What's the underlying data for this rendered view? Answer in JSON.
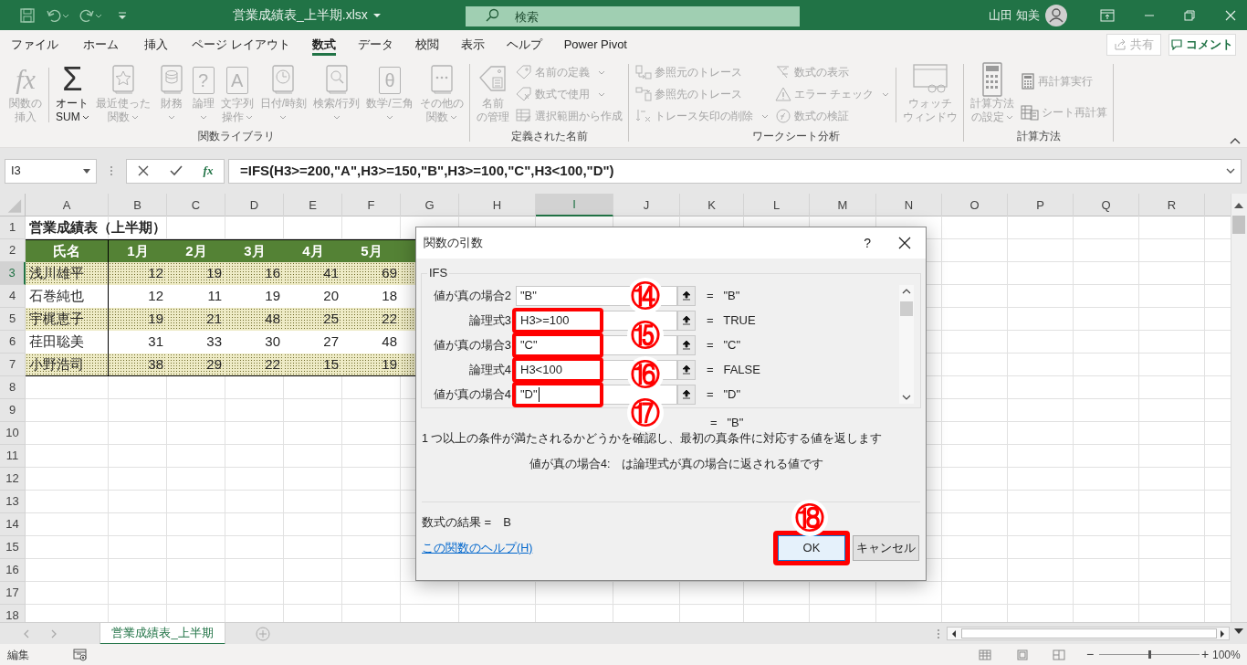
{
  "title_bar": {
    "filename": "営業成績表_上半期.xlsx",
    "search_placeholder": "検索",
    "user": "山田 知美"
  },
  "ribbon_tabs": [
    {
      "label": "ファイル",
      "selected": false
    },
    {
      "label": "ホーム",
      "selected": false
    },
    {
      "label": "挿入",
      "selected": false
    },
    {
      "label": "ページ レイアウト",
      "selected": false
    },
    {
      "label": "数式",
      "selected": true
    },
    {
      "label": "データ",
      "selected": false
    },
    {
      "label": "校閲",
      "selected": false
    },
    {
      "label": "表示",
      "selected": false
    },
    {
      "label": "ヘルプ",
      "selected": false
    },
    {
      "label": "Power Pivot",
      "selected": false
    }
  ],
  "share_button": {
    "label": "共有",
    "disabled": true
  },
  "comment_button": {
    "label": "コメント"
  },
  "ribbon_groups": [
    {
      "label": "関数ライブラリ",
      "buttons": [
        {
          "kind": "large",
          "glyph": "fx",
          "lines": [
            "関数の",
            "挿入"
          ],
          "dropdown": false,
          "disabled": true,
          "separated": true
        },
        {
          "kind": "large",
          "glyph": "Σ",
          "lines": [
            "オート",
            "SUM"
          ],
          "dropdown": true,
          "disabled": false,
          "separated": false
        },
        {
          "kind": "large",
          "lines": [
            "最近使った",
            "関数"
          ],
          "dropdown": true,
          "disabled": true,
          "separated": false
        },
        {
          "kind": "large",
          "lines": [
            "財務"
          ],
          "dropdown": true,
          "disabled": true,
          "separated": false
        },
        {
          "kind": "large",
          "glyph": "?",
          "lines": [
            "論理"
          ],
          "dropdown": true,
          "disabled": true,
          "separated": false
        },
        {
          "kind": "large",
          "glyph": "A",
          "lines": [
            "文字列",
            "操作"
          ],
          "dropdown": true,
          "disabled": true,
          "separated": false
        },
        {
          "kind": "large",
          "lines": [
            "日付/時刻"
          ],
          "dropdown": true,
          "disabled": true,
          "separated": false
        },
        {
          "kind": "large",
          "lines": [
            "検索/行列"
          ],
          "dropdown": true,
          "disabled": true,
          "separated": false
        },
        {
          "kind": "large",
          "glyph": "θ",
          "lines": [
            "数学/三角"
          ],
          "dropdown": true,
          "disabled": true,
          "separated": false
        },
        {
          "kind": "large",
          "lines": [
            "その他の",
            "関数"
          ],
          "dropdown": true,
          "disabled": true,
          "separated": false
        }
      ]
    },
    {
      "label": "定義された名前",
      "buttons": [
        {
          "kind": "large",
          "lines": [
            "名前",
            "の管理"
          ],
          "dropdown": false,
          "disabled": true,
          "separated": false
        },
        {
          "kind": "small",
          "lines": [
            "名前の定義"
          ],
          "dropdown": true,
          "disabled": true,
          "separated": false
        },
        {
          "kind": "small",
          "lines": [
            "数式で使用"
          ],
          "dropdown": true,
          "disabled": true,
          "separated": false
        },
        {
          "kind": "small",
          "lines": [
            "選択範囲から作成"
          ],
          "dropdown": false,
          "disabled": true,
          "separated": false
        }
      ]
    },
    {
      "label": "ワークシート分析",
      "buttons": [
        {
          "kind": "small",
          "lines": [
            "参照元のトレース"
          ],
          "dropdown": false,
          "disabled": true,
          "separated": false
        },
        {
          "kind": "small",
          "lines": [
            "参照先のトレース"
          ],
          "dropdown": false,
          "disabled": true,
          "separated": false
        },
        {
          "kind": "small",
          "lines": [
            "トレース矢印の削除"
          ],
          "dropdown": true,
          "disabled": true,
          "separated": false
        },
        {
          "kind": "small",
          "lines": [
            "数式の表示"
          ],
          "dropdown": false,
          "disabled": true,
          "separated": false
        },
        {
          "kind": "small",
          "lines": [
            "エラー チェック"
          ],
          "dropdown": true,
          "disabled": true,
          "separated": false
        },
        {
          "kind": "small",
          "lines": [
            "数式の検証"
          ],
          "dropdown": false,
          "disabled": true,
          "separated": true
        },
        {
          "kind": "large",
          "lines": [
            "ウォッチ",
            "ウィンドウ"
          ],
          "dropdown": false,
          "disabled": true,
          "separated": false
        }
      ]
    },
    {
      "label": "計算方法",
      "buttons": [
        {
          "kind": "large",
          "lines": [
            "計算方法",
            "の設定"
          ],
          "dropdown": true,
          "disabled": true,
          "separated": false
        },
        {
          "kind": "small",
          "lines": [
            "再計算実行"
          ],
          "dropdown": false,
          "disabled": true,
          "separated": false
        },
        {
          "kind": "small",
          "lines": [
            "シート再計算"
          ],
          "dropdown": false,
          "disabled": true,
          "separated": false
        }
      ]
    }
  ],
  "formula_bar": {
    "name_box": "I3",
    "fx": "fx",
    "formula": "=IFS(H3>=200,\"A\",H3>=150,\"B\",H3>=100,\"C\",H3<100,\"D\")"
  },
  "sheet": {
    "columns": [
      {
        "label": "A",
        "selected": false
      },
      {
        "label": "B",
        "selected": false
      },
      {
        "label": "C",
        "selected": false
      },
      {
        "label": "D",
        "selected": false
      },
      {
        "label": "E",
        "selected": false
      },
      {
        "label": "F",
        "selected": false
      },
      {
        "label": "G",
        "selected": false
      },
      {
        "label": "H",
        "selected": false
      },
      {
        "label": "I",
        "selected": true
      },
      {
        "label": "J",
        "selected": false
      },
      {
        "label": "K",
        "selected": false
      },
      {
        "label": "L",
        "selected": false
      },
      {
        "label": "M",
        "selected": false
      },
      {
        "label": "N",
        "selected": false
      },
      {
        "label": "O",
        "selected": false
      },
      {
        "label": "P",
        "selected": false
      },
      {
        "label": "Q",
        "selected": false
      },
      {
        "label": "R",
        "selected": false
      }
    ],
    "rows": [
      {
        "number": "1",
        "selected": false,
        "kind": "title",
        "cells": [
          "営業成績表（上半期）"
        ]
      },
      {
        "number": "2",
        "selected": false,
        "kind": "header",
        "cells": [
          "氏名",
          "1月",
          "2月",
          "3月",
          "4月",
          "5月"
        ]
      },
      {
        "number": "3",
        "selected": true,
        "kind": "data",
        "banded": true,
        "cells": [
          "浅川雄平",
          "12",
          "19",
          "16",
          "41",
          "69"
        ]
      },
      {
        "number": "4",
        "selected": false,
        "kind": "data",
        "banded": false,
        "cells": [
          "石巻純也",
          "12",
          "11",
          "19",
          "20",
          "18"
        ]
      },
      {
        "number": "5",
        "selected": false,
        "kind": "data",
        "banded": true,
        "cells": [
          "宇梶恵子",
          "19",
          "21",
          "48",
          "25",
          "22"
        ]
      },
      {
        "number": "6",
        "selected": false,
        "kind": "data",
        "banded": false,
        "cells": [
          "荏田聡美",
          "31",
          "33",
          "30",
          "27",
          "48"
        ]
      },
      {
        "number": "7",
        "selected": false,
        "kind": "data",
        "banded": true,
        "cells": [
          "小野浩司",
          "38",
          "29",
          "22",
          "15",
          "19"
        ]
      },
      {
        "number": "8",
        "selected": false,
        "kind": "empty"
      },
      {
        "number": "9",
        "selected": false,
        "kind": "empty"
      },
      {
        "number": "10",
        "selected": false,
        "kind": "empty"
      },
      {
        "number": "11",
        "selected": false,
        "kind": "empty"
      },
      {
        "number": "12",
        "selected": false,
        "kind": "empty"
      },
      {
        "number": "13",
        "selected": false,
        "kind": "empty"
      },
      {
        "number": "14",
        "selected": false,
        "kind": "empty"
      },
      {
        "number": "15",
        "selected": false,
        "kind": "empty"
      },
      {
        "number": "16",
        "selected": false,
        "kind": "empty"
      },
      {
        "number": "17",
        "selected": false,
        "kind": "empty"
      },
      {
        "number": "18",
        "selected": false,
        "kind": "empty"
      }
    ]
  },
  "dialog": {
    "title": "関数の引数",
    "help": "?",
    "function_name": "IFS",
    "arguments": [
      {
        "label": "値が真の場合2",
        "value": "\"B\"",
        "result": "=   \"B\"",
        "highlighted": false,
        "focused": false
      },
      {
        "label": "論理式3",
        "value": "H3>=100",
        "result": "=   TRUE",
        "highlighted": true,
        "focused": false
      },
      {
        "label": "値が真の場合3",
        "value": "\"C\"",
        "result": "=   \"C\"",
        "highlighted": true,
        "focused": false
      },
      {
        "label": "論理式4",
        "value": "H3<100",
        "result": "=   FALSE",
        "highlighted": true,
        "focused": false
      },
      {
        "label": "値が真の場合4",
        "value": "\"D\"",
        "result": "=   \"D\"",
        "highlighted": true,
        "focused": true
      }
    ],
    "total_result": "=   \"B\"",
    "description": "1 つ以上の条件が満たされるかどうかを確認し、最初の真条件に対応する値を返します",
    "argument_help": "値が真の場合4:　は論理式が真の場合に返される値です",
    "formula_result": "数式の結果 =　B",
    "help_link": "この関数のヘルプ(H)",
    "buttons": [
      {
        "label": "OK",
        "highlighted": true
      },
      {
        "label": "キャンセル",
        "highlighted": false
      }
    ]
  },
  "annotations": [
    "⑭",
    "⑮",
    "⑯",
    "⑰",
    "⑱"
  ],
  "sheet_tabs": [
    {
      "label": "営業成績表_上半期",
      "selected": true
    }
  ],
  "status_bar": {
    "mode": "編集",
    "zoom_out": "−",
    "zoom_in": "+",
    "zoom": "100%"
  }
}
